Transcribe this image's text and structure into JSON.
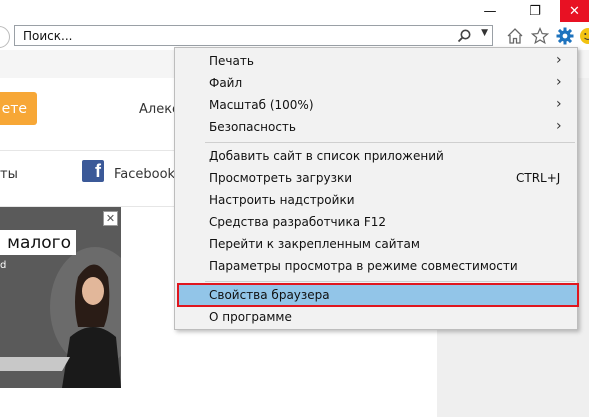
{
  "window": {
    "minimize_glyph": "—",
    "restore_glyph": "❐",
    "close_glyph": "✕"
  },
  "navbar": {
    "address_text": "Поиск...",
    "dropdown_glyph": "▼",
    "icons": [
      "home-icon",
      "star-icon",
      "gear-icon",
      "smile-icon"
    ]
  },
  "page": {
    "orange_button_text": "ете",
    "user_name_fragment": "Алексе",
    "left_fragment": "ты",
    "facebook_logo": "f",
    "facebook_label": "Facebook",
    "ad": {
      "close_glyph": "✕",
      "headline": "малого",
      "sub_fragment": "d"
    }
  },
  "menu": {
    "items": [
      {
        "label": "Печать",
        "arrow": "›"
      },
      {
        "label": "Файл",
        "arrow": "›"
      },
      {
        "label": "Масштаб (100%)",
        "arrow": "›"
      },
      {
        "label": "Безопасность",
        "arrow": "›"
      },
      {
        "label": "Добавить сайт в список приложений"
      },
      {
        "label": "Просмотреть загрузки",
        "shortcut": "CTRL+J"
      },
      {
        "label": "Настроить надстройки"
      },
      {
        "label": "Средства разработчика F12"
      },
      {
        "label": "Перейти к закрепленным сайтам"
      },
      {
        "label": "Параметры просмотра в режиме совместимости"
      },
      {
        "label": "Свойства браузера",
        "highlighted": true
      },
      {
        "label": "О программе"
      }
    ]
  },
  "colors": {
    "accent_orange": "#f7a736",
    "highlight_blue": "#92c5e8",
    "highlight_border_red": "#e0161e",
    "close_red": "#e81123",
    "gear_blue": "#1e73be",
    "facebook_blue": "#3b5998"
  }
}
